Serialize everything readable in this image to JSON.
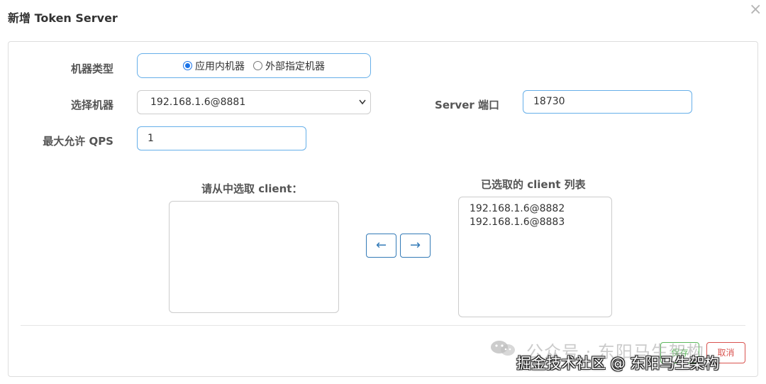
{
  "dialog": {
    "title": "新增 Token Server",
    "close_label": "×"
  },
  "form": {
    "machine_type": {
      "label": "机器类型",
      "options": [
        "应用内机器",
        "外部指定机器"
      ],
      "selected": "应用内机器"
    },
    "select_machine": {
      "label": "选择机器",
      "value": "192.168.1.6@8881"
    },
    "server_port": {
      "label": "Server 端口",
      "value": "18730"
    },
    "max_qps": {
      "label": "最大允许 QPS",
      "value": "1"
    }
  },
  "client_lists": {
    "available_heading": "请从中选取 client：",
    "available_items": [],
    "selected_heading": "已选取的 client 列表",
    "selected_items": [
      "192.168.1.6@8882",
      "192.168.1.6@8883"
    ],
    "move_left_label": "←",
    "move_right_label": "→"
  },
  "footer": {
    "save_label": "保存",
    "cancel_label": "取消",
    "save_color": "#5cb85c",
    "cancel_color": "#d9534f"
  },
  "overlays": {
    "watermark_text": "公众号 · 东阳马生架构",
    "credit_text": "掘金技术社区 @ 东阳马生架构"
  },
  "colors": {
    "focus_border": "#66afe9",
    "button_blue": "#337ab7",
    "radio_blue": "#1a73e8"
  }
}
